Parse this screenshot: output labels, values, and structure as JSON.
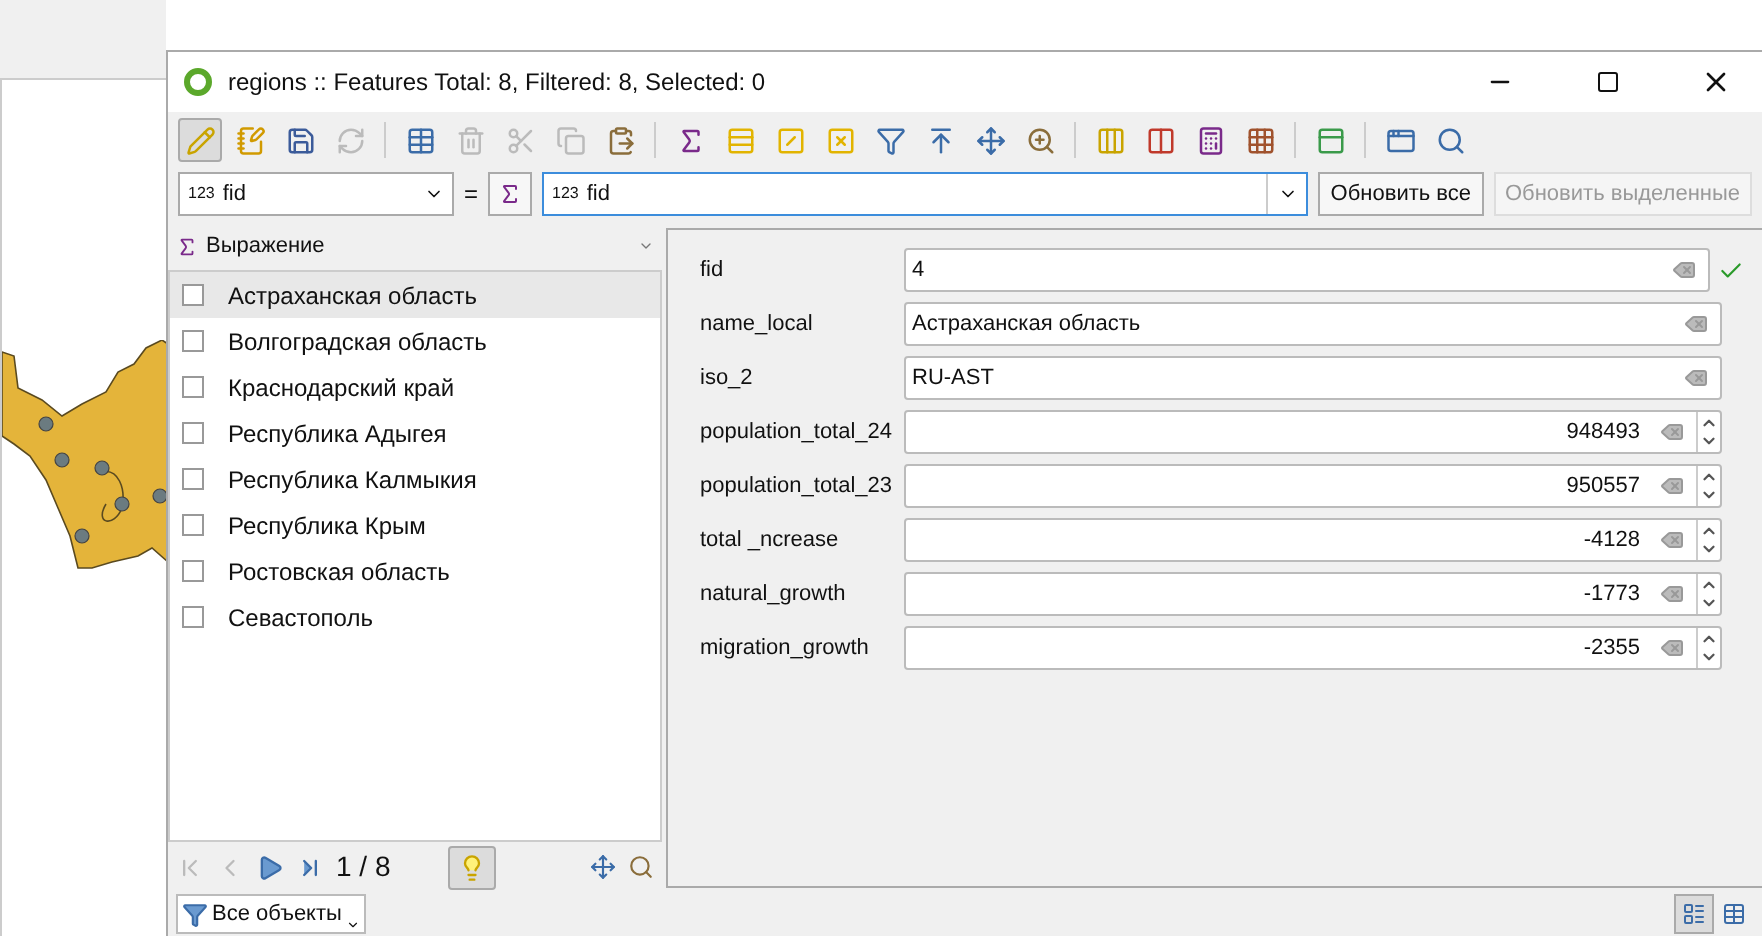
{
  "window": {
    "title": "regions :: Features Total: 8, Filtered: 8, Selected: 0"
  },
  "toolbar": [
    {
      "kind": "pencil",
      "selected": true,
      "disabled": false
    },
    {
      "kind": "multiedit",
      "selected": false,
      "disabled": false
    },
    {
      "kind": "save",
      "selected": false,
      "disabled": false
    },
    {
      "kind": "reload",
      "selected": false,
      "disabled": true
    },
    {
      "kind": "sep"
    },
    {
      "kind": "addrow",
      "selected": false,
      "disabled": false
    },
    {
      "kind": "delete",
      "selected": false,
      "disabled": true
    },
    {
      "kind": "cut",
      "selected": false,
      "disabled": true
    },
    {
      "kind": "copy",
      "selected": false,
      "disabled": true
    },
    {
      "kind": "paste",
      "selected": false,
      "disabled": false
    },
    {
      "kind": "sep"
    },
    {
      "kind": "expression",
      "selected": false,
      "disabled": false
    },
    {
      "kind": "selectall",
      "selected": false,
      "disabled": false
    },
    {
      "kind": "invert",
      "selected": false,
      "disabled": false
    },
    {
      "kind": "deselect",
      "selected": false,
      "disabled": false
    },
    {
      "kind": "filter",
      "selected": false,
      "disabled": false
    },
    {
      "kind": "movetop",
      "selected": false,
      "disabled": false
    },
    {
      "kind": "pan",
      "selected": false,
      "disabled": false
    },
    {
      "kind": "zoom",
      "selected": false,
      "disabled": false
    },
    {
      "kind": "sep"
    },
    {
      "kind": "newfield",
      "selected": false,
      "disabled": false
    },
    {
      "kind": "delfield",
      "selected": false,
      "disabled": false
    },
    {
      "kind": "calc",
      "selected": false,
      "disabled": false
    },
    {
      "kind": "table",
      "selected": false,
      "disabled": false
    },
    {
      "kind": "sep"
    },
    {
      "kind": "dock",
      "selected": false,
      "disabled": false
    },
    {
      "kind": "sep"
    },
    {
      "kind": "actions",
      "selected": false,
      "disabled": false
    },
    {
      "kind": "search",
      "selected": false,
      "disabled": false
    }
  ],
  "field_bar": {
    "field_prefix": "123",
    "field": "fid",
    "equals": "=",
    "expression_prefix": "123",
    "expression": "fid",
    "buttons": [
      {
        "label": "Обновить все",
        "disabled": false
      },
      {
        "label": "Обновить выделенные",
        "disabled": true
      }
    ]
  },
  "list": {
    "header": "Выражение",
    "items": [
      {
        "label": "Астраханская область",
        "selected": true,
        "checked": false
      },
      {
        "label": "Волгоградская область",
        "selected": false,
        "checked": false
      },
      {
        "label": "Краснодарский край",
        "selected": false,
        "checked": false
      },
      {
        "label": "Республика Адыгея",
        "selected": false,
        "checked": false
      },
      {
        "label": "Республика Калмыкия",
        "selected": false,
        "checked": false
      },
      {
        "label": "Республика Крым",
        "selected": false,
        "checked": false
      },
      {
        "label": "Ростовская область",
        "selected": false,
        "checked": false
      },
      {
        "label": "Севастополь",
        "selected": false,
        "checked": false
      }
    ]
  },
  "navigation": {
    "first_disabled": true,
    "prev_disabled": true,
    "next_disabled": false,
    "last_disabled": false,
    "position": "1 / 8",
    "highlight_on": true
  },
  "form": [
    {
      "label": "fid",
      "value": "4",
      "kind": "text",
      "valid": true
    },
    {
      "label": "name_local",
      "value": "Астраханская область",
      "kind": "text",
      "valid": false
    },
    {
      "label": "iso_2",
      "value": "RU-AST",
      "kind": "text",
      "valid": false
    },
    {
      "label": "population_total_24",
      "value": "948493",
      "kind": "number",
      "valid": false
    },
    {
      "label": "population_total_23",
      "value": "950557",
      "kind": "number",
      "valid": false
    },
    {
      "label": "total _ncrease",
      "value": "-4128",
      "kind": "number",
      "valid": false
    },
    {
      "label": "natural_growth",
      "value": "-1773",
      "kind": "number",
      "valid": false
    },
    {
      "label": "migration_growth",
      "value": "-2355",
      "kind": "number",
      "valid": false
    }
  ],
  "status_bar": {
    "filter": "Все объекты",
    "views": [
      {
        "kind": "form",
        "selected": true
      },
      {
        "kind": "table",
        "selected": false
      }
    ]
  }
}
